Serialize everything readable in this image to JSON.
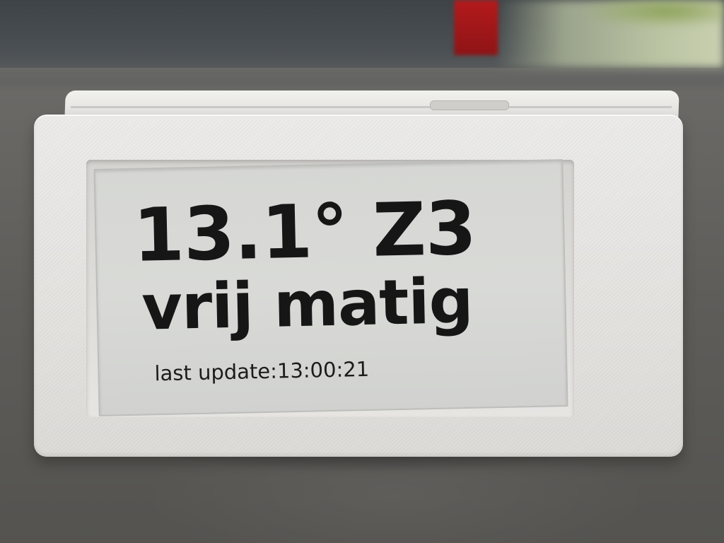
{
  "display": {
    "temperature": "13.1°",
    "wind_force": "Z3",
    "wind_description": "vrij matig",
    "update_label": "last update:",
    "update_time": "13:00:21"
  }
}
